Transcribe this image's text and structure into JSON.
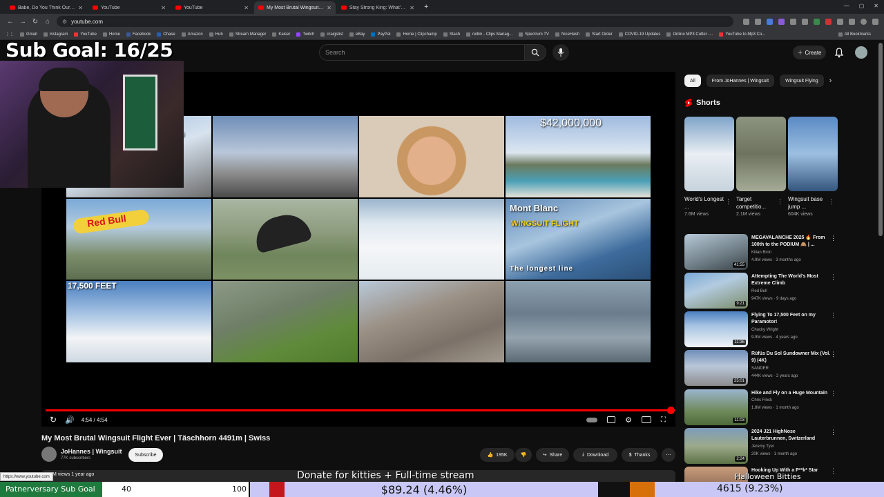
{
  "browser": {
    "tabs": [
      {
        "title": "Babe, Do You Think Our Waitre",
        "active": false
      },
      {
        "title": "YouTube",
        "active": false
      },
      {
        "title": "YouTube",
        "active": false
      },
      {
        "title": "My Most Brutal Wingsuit Flight",
        "active": true
      },
      {
        "title": "Stay Strong King: What's Your",
        "active": false
      }
    ],
    "new_tab": "+",
    "url": "youtube.com",
    "bookmarks": [
      "Gmail",
      "Instagram",
      "YouTube",
      "Home",
      "Facebook",
      "Chase",
      "Amazon",
      "Hub",
      "Stream Manager",
      "Kaiser",
      "Twitch",
      "craigslist",
      "eBay",
      "PayPal",
      "Home | Clipchamp",
      "Stash",
      "rellim - Clips Manag...",
      "Spectrum TV",
      "NiceHash",
      "Start Order",
      "COVID-19 Updates",
      "Online MP3 Cutter -...",
      "YouTube to Mp3 Co..."
    ],
    "all_bookmarks": "All Bookmarks",
    "status_url": "https://www.youtube.com"
  },
  "youtube": {
    "search_placeholder": "Search",
    "create_label": "Create"
  },
  "overlay": {
    "sub_goal": "Sub Goal: 16/25",
    "donate_text": "Donate for kitties + Full-time stream",
    "patnerversary_label": "Patnerversary Sub Goal",
    "patnerversary_current": "40",
    "patnerversary_target": "100",
    "donation_amount": "$89.24 (4.46%)",
    "sub_count": "4615 (9.23%)"
  },
  "video": {
    "overlay_labels": {
      "price": "$42,000,000",
      "mont_blanc": "Mont Blanc",
      "wingsuit_flight": "WINGSUIT    FLIGHT",
      "longest_line": "The longest line",
      "feet": "17,500 FEET",
      "cam_small": "20"
    },
    "time": "4:54 / 4:54",
    "progress": 1.0,
    "title": "My Most Brutal Wingsuit Flight Ever | Täschhorn 4491m | Swiss",
    "channel": "JoHannes | Wingsuit",
    "subscribers": "77K subscribers",
    "subscribe_label": "Subscribe",
    "likes": "195K",
    "share_label": "Share",
    "download_label": "Download",
    "thanks_label": "Thanks",
    "views_line": "M views  1 year ago"
  },
  "sidebar": {
    "chips": [
      "All",
      "From JoHannes | Wingsuit",
      "Wingsuit Flying"
    ],
    "shorts_header": "Shorts",
    "shorts": [
      {
        "title": "World's Longest ...",
        "views": "7.6M views"
      },
      {
        "title": "Target competitio...",
        "views": "2.1M views"
      },
      {
        "title": "Wingsuit base jump ...",
        "views": "604K views"
      }
    ],
    "recommended": [
      {
        "title": "MEGAVALANCHE 2025 🔥 From 100th to the PODIUM 🙈 | ...",
        "channel": "Kilian Bron",
        "meta": "4.9M views · 3 months ago",
        "duration": "41:55"
      },
      {
        "title": "Attempting The World's Most Extreme Climb",
        "channel": "Red Bull",
        "meta": "947K views · 9 days ago",
        "duration": "9:21"
      },
      {
        "title": "Flying To 17,500 Feet on my Paramotor!",
        "channel": "Chucky Wright",
        "meta": "9.9M views · 4 years ago",
        "duration": "11:36"
      },
      {
        "title": "Rüfüs Du Sol Sundowner Mix (Vol. 9) (4K)",
        "channel": "SANDER",
        "meta": "444K views · 2 years ago",
        "duration": "25:01"
      },
      {
        "title": "Hike and Fly on a Huge Mountain",
        "channel": "Chris Finck",
        "meta": "1.8M views · 1 month ago",
        "duration": "11:03"
      },
      {
        "title": "2024 J21 HighNose Lauterbrunnen, Switzerland",
        "channel": "Jeremy Tyer",
        "meta": "20K views · 1 month ago",
        "duration": "2:24"
      },
      {
        "title": "Hooking Up With a P**k* Star",
        "channel": "",
        "meta": "",
        "duration": ""
      }
    ],
    "bottom_overlay_text": "Halloween Bitties"
  },
  "colors": {
    "yt_bg": "#0f0f0f",
    "progress_red": "#ff0000",
    "goal_green": "#1f7a3d",
    "donate_purple": "#c8c7f5"
  }
}
